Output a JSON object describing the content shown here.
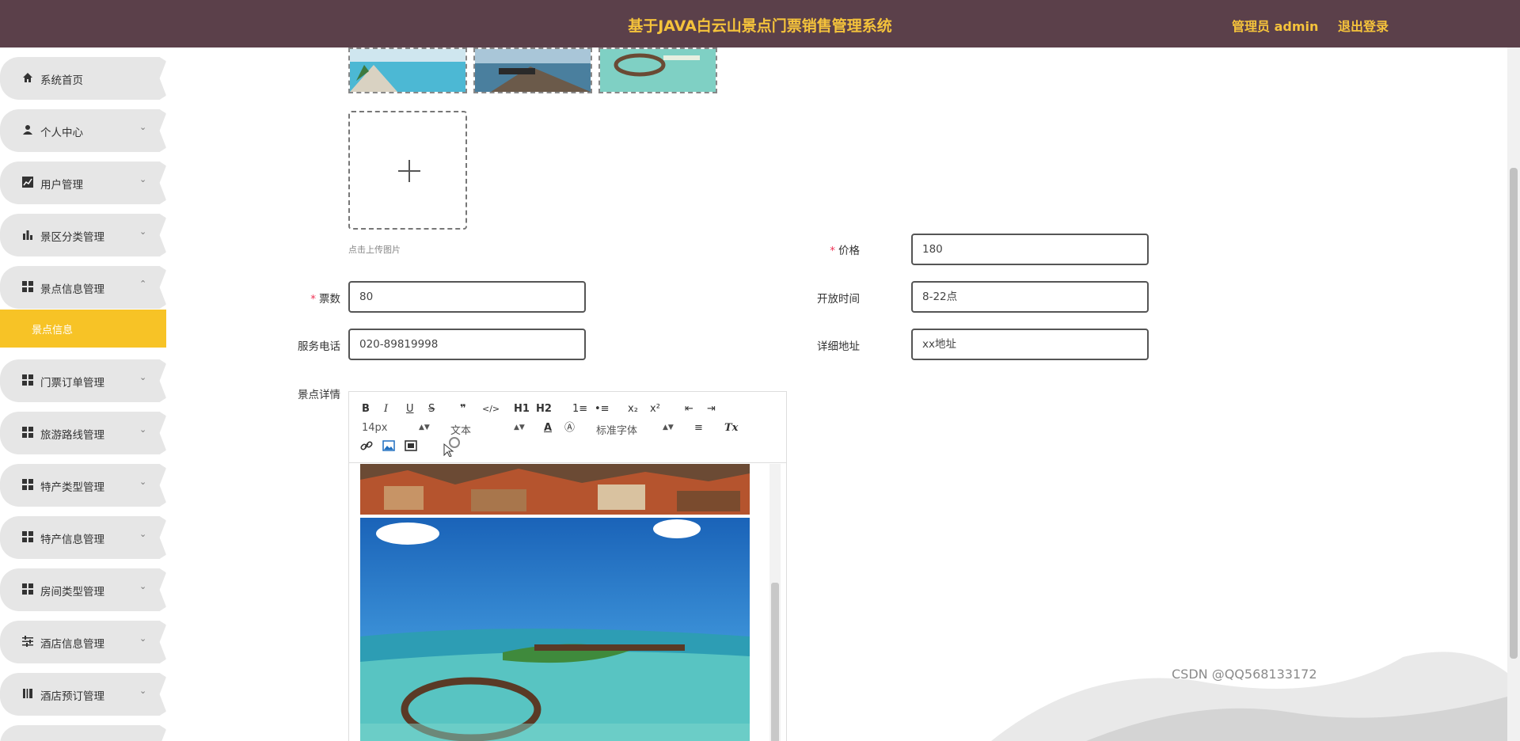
{
  "header": {
    "title": "基于JAVA白云山景点门票销售管理系统",
    "user_label": "管理员 admin",
    "logout_label": "退出登录"
  },
  "sidebar": {
    "items": [
      {
        "label": "系统首页",
        "icon": "home-icon",
        "arrow": ""
      },
      {
        "label": "个人中心",
        "icon": "user-icon",
        "arrow": "⌄"
      },
      {
        "label": "用户管理",
        "icon": "chart-line-icon",
        "arrow": "⌄"
      },
      {
        "label": "景区分类管理",
        "icon": "bar-chart-icon",
        "arrow": "⌄"
      },
      {
        "label": "景点信息管理",
        "icon": "grid-icon",
        "arrow": "⌃"
      },
      {
        "label": "门票订单管理",
        "icon": "grid-icon",
        "arrow": "⌄"
      },
      {
        "label": "旅游路线管理",
        "icon": "grid-icon",
        "arrow": "⌄"
      },
      {
        "label": "特产类型管理",
        "icon": "grid-icon",
        "arrow": "⌄"
      },
      {
        "label": "特产信息管理",
        "icon": "grid-icon",
        "arrow": "⌄"
      },
      {
        "label": "房间类型管理",
        "icon": "grid-icon",
        "arrow": "⌄"
      },
      {
        "label": "酒店信息管理",
        "icon": "sliders-icon",
        "arrow": "⌄"
      },
      {
        "label": "酒店预订管理",
        "icon": "book-icon",
        "arrow": "⌄"
      }
    ],
    "active_sub": "景点信息"
  },
  "form": {
    "upload_hint": "点击上传图片",
    "price_label": "价格",
    "price_value": "180",
    "tickets_label": "票数",
    "tickets_value": "80",
    "open_time_label": "开放时间",
    "open_time_value": "8-22点",
    "phone_label": "服务电话",
    "phone_value": "020-89819998",
    "address_label": "详细地址",
    "address_value": "xx地址",
    "detail_label": "景点详情"
  },
  "editor": {
    "font_size": "14px",
    "text_style": "文本",
    "font_family": "标准字体",
    "buttons": [
      "B",
      "I",
      "U",
      "S",
      "❞",
      "</>",
      "H1",
      "H2",
      "1≡",
      "•≡",
      "x₂",
      "x²",
      "⇤",
      "⇥",
      "A",
      "Ⓐ",
      "≡",
      "Tx"
    ]
  },
  "watermark": "CSDN @QQ568133172",
  "colors": {
    "topbar": "#5b404a",
    "accent": "#f7c326",
    "title": "#f5c33b"
  }
}
